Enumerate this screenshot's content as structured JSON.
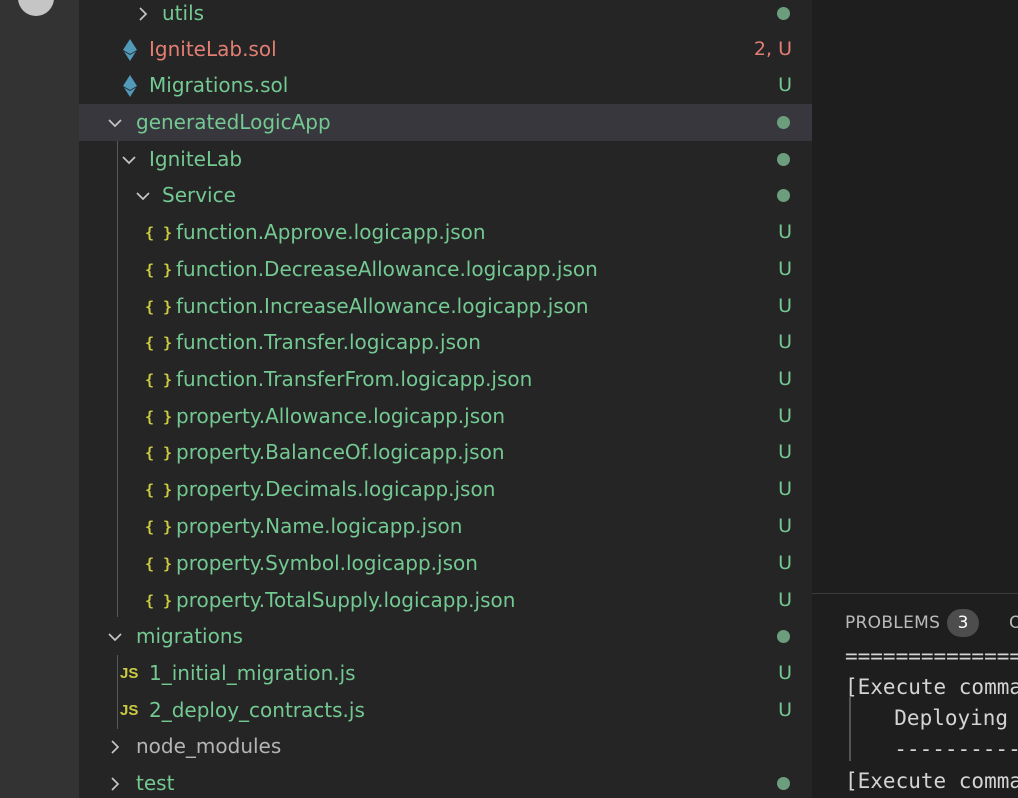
{
  "explorer": {
    "rows": [
      {
        "kind": "folder",
        "expanded": false,
        "label": "utils",
        "status": "dot",
        "color": "#73c991"
      },
      {
        "kind": "sol",
        "icon": "ethereum-icon",
        "label": "IgniteLab.sol",
        "badge": "2, U",
        "color": "#e27e72"
      },
      {
        "kind": "sol",
        "icon": "ethereum-icon",
        "label": "Migrations.sol",
        "badge": "U",
        "color": "#73c991"
      },
      {
        "kind": "folder",
        "expanded": true,
        "label": "generatedLogicApp",
        "status": "dot",
        "color": "#73c991",
        "selected": true
      },
      {
        "kind": "folder",
        "expanded": true,
        "label": "IgniteLab",
        "status": "dot",
        "color": "#73c991"
      },
      {
        "kind": "folder",
        "expanded": true,
        "label": "Service",
        "status": "dot",
        "color": "#73c991"
      },
      {
        "kind": "json",
        "icon": "json-braces-icon",
        "icon_text": "{}",
        "label": "function.Approve.logicapp.json",
        "badge": "U"
      },
      {
        "kind": "json",
        "icon": "json-braces-icon",
        "icon_text": "{}",
        "label": "function.DecreaseAllowance.logicapp.json",
        "badge": "U"
      },
      {
        "kind": "json",
        "icon": "json-braces-icon",
        "icon_text": "{}",
        "label": "function.IncreaseAllowance.logicapp.json",
        "badge": "U"
      },
      {
        "kind": "json",
        "icon": "json-braces-icon",
        "icon_text": "{}",
        "label": "function.Transfer.logicapp.json",
        "badge": "U"
      },
      {
        "kind": "json",
        "icon": "json-braces-icon",
        "icon_text": "{}",
        "label": "function.TransferFrom.logicapp.json",
        "badge": "U"
      },
      {
        "kind": "json",
        "icon": "json-braces-icon",
        "icon_text": "{}",
        "label": "property.Allowance.logicapp.json",
        "badge": "U"
      },
      {
        "kind": "json",
        "icon": "json-braces-icon",
        "icon_text": "{}",
        "label": "property.BalanceOf.logicapp.json",
        "badge": "U"
      },
      {
        "kind": "json",
        "icon": "json-braces-icon",
        "icon_text": "{}",
        "label": "property.Decimals.logicapp.json",
        "badge": "U"
      },
      {
        "kind": "json",
        "icon": "json-braces-icon",
        "icon_text": "{}",
        "label": "property.Name.logicapp.json",
        "badge": "U"
      },
      {
        "kind": "json",
        "icon": "json-braces-icon",
        "icon_text": "{}",
        "label": "property.Symbol.logicapp.json",
        "badge": "U"
      },
      {
        "kind": "json",
        "icon": "json-braces-icon",
        "icon_text": "{}",
        "label": "property.TotalSupply.logicapp.json",
        "badge": "U"
      },
      {
        "kind": "folder",
        "expanded": true,
        "label": "migrations",
        "status": "dot",
        "color": "#73c991"
      },
      {
        "kind": "js",
        "icon": "js-file-icon",
        "icon_text": "JS",
        "label": "1_initial_migration.js",
        "badge": "U"
      },
      {
        "kind": "js",
        "icon": "js-file-icon",
        "icon_text": "JS",
        "label": "2_deploy_contracts.js",
        "badge": "U"
      },
      {
        "kind": "folder",
        "expanded": false,
        "label": "node_modules",
        "status": "none",
        "color": "#b4b4b4"
      },
      {
        "kind": "folder",
        "expanded": false,
        "label": "test",
        "status": "dot",
        "color": "#73c991"
      }
    ]
  },
  "panel": {
    "tabs": {
      "problems_label": "PROBLEMS",
      "problems_count": "3",
      "next_tab_partial": "O"
    },
    "terminal": {
      "lines": [
        "==============",
        "[Execute comma",
        "  Deploying '",
        "  -----------",
        "[Execute comma"
      ]
    }
  },
  "colors": {
    "untracked_green": "#73c991",
    "error_red": "#e27e72",
    "json_yellow": "#cbcb41",
    "sol_blue": "#519aba",
    "selected_row": "#37373d"
  }
}
